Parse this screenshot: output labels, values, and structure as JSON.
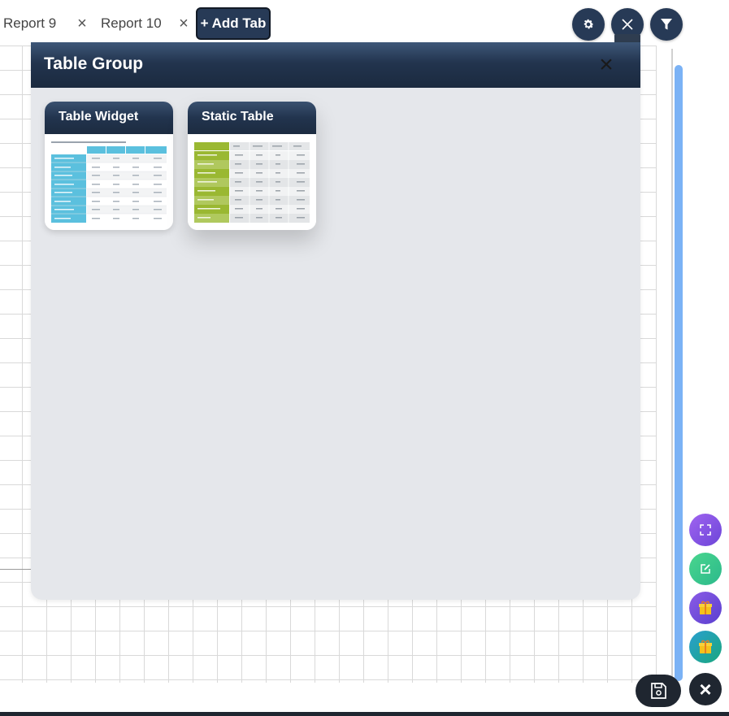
{
  "tabs": [
    {
      "label": "Report 9"
    },
    {
      "label": "Report 10"
    }
  ],
  "tab_close_glyph": "×",
  "add_tab_label": "+ Add Tab",
  "toolbar": {
    "settings_icon": "gear-icon",
    "close_icon": "close-icon",
    "filter_icon": "filter-icon"
  },
  "modal": {
    "title": "Table Group",
    "close_glyph": "×",
    "cards": [
      {
        "title": "Table Widget",
        "accent": "#5bc0de"
      },
      {
        "title": "Static Table",
        "accent": "#9ab832"
      }
    ]
  },
  "colors": {
    "navy": "#273a56",
    "scrollbar": "#7bb2f5",
    "fab_expand": "#8e58ea",
    "fab_edit": "#3cc98a",
    "fab_gift1": "#7b4de0",
    "fab_gift2": "#1f9e8c"
  },
  "fabs": [
    {
      "name": "expand",
      "icon": "expand-icon"
    },
    {
      "name": "edit",
      "icon": "edit-icon"
    },
    {
      "name": "gift-a",
      "icon": "gift-icon"
    },
    {
      "name": "gift-b",
      "icon": "gift-icon"
    }
  ],
  "save_icon": "save-icon",
  "close_fab_glyph": "×"
}
